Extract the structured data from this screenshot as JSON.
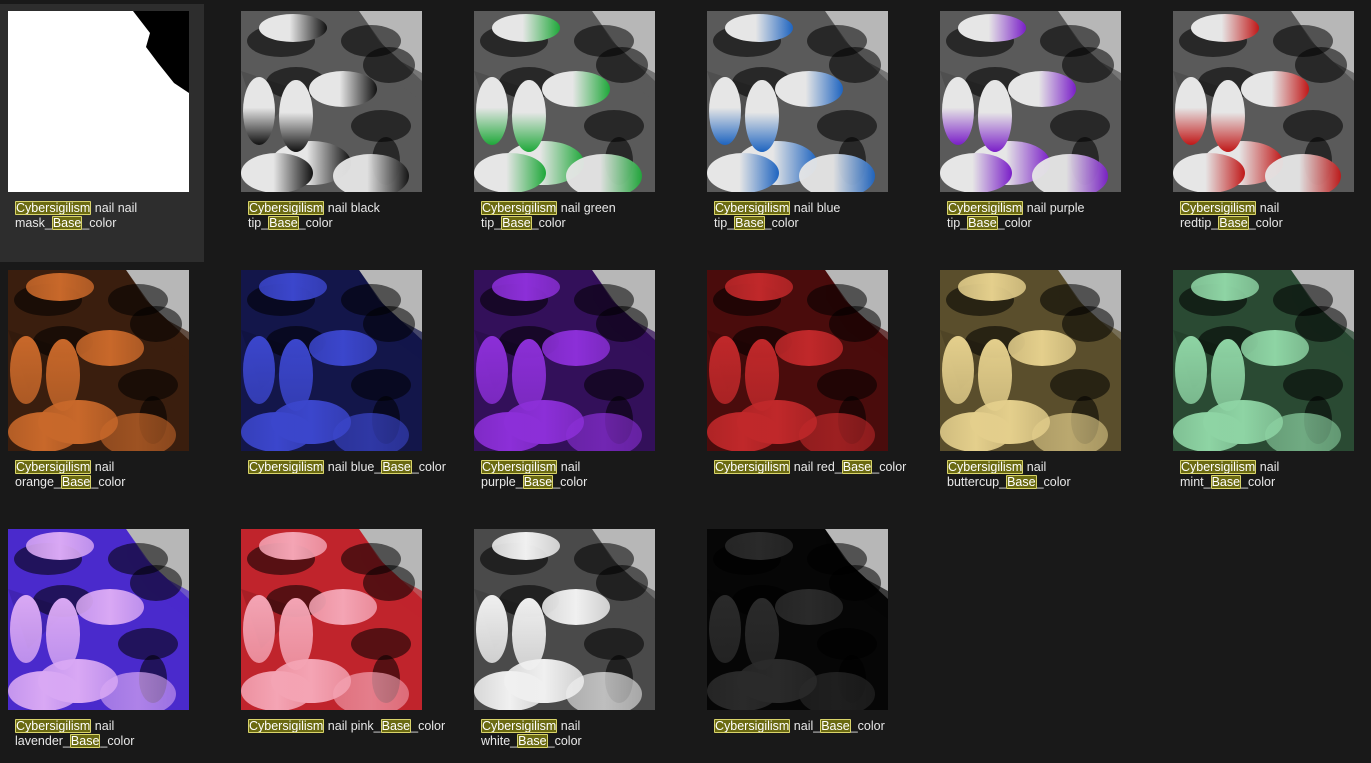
{
  "search_highlight": "Cybersigilism",
  "highlight_color": "#6b6a12",
  "items": [
    {
      "line1_pre": "",
      "hl1": "Cybersigilism",
      "line1_post": " nail nail",
      "line2_pre": "mask_",
      "hl2": "Base",
      "line2_post": "_color",
      "style": "mask",
      "base": "#ffffff",
      "tip": "#ffffff",
      "bg": "#000000",
      "selected": true
    },
    {
      "line1_pre": "",
      "hl1": "Cybersigilism",
      "line1_post": " nail black",
      "line2_pre": "tip_",
      "hl2": "Base",
      "line2_post": "_color",
      "style": "tip",
      "base": "#e6e6e6",
      "tip": "#111111",
      "bg": "#5a5a5a"
    },
    {
      "line1_pre": "",
      "hl1": "Cybersigilism",
      "line1_post": " nail green",
      "line2_pre": "tip_",
      "hl2": "Base",
      "line2_post": "_color",
      "style": "tip",
      "base": "#e6e6e6",
      "tip": "#1fa83a",
      "bg": "#5a5a5a"
    },
    {
      "line1_pre": "",
      "hl1": "Cybersigilism",
      "line1_post": " nail blue",
      "line2_pre": "tip_",
      "hl2": "Base",
      "line2_post": "_color",
      "style": "tip",
      "base": "#e6e6e6",
      "tip": "#1e64c0",
      "bg": "#5a5a5a"
    },
    {
      "line1_pre": "",
      "hl1": "Cybersigilism",
      "line1_post": " nail purple",
      "line2_pre": "tip_",
      "hl2": "Base",
      "line2_post": "_color",
      "style": "tip",
      "base": "#e6e6e6",
      "tip": "#7a1fc8",
      "bg": "#5a5a5a"
    },
    {
      "line1_pre": "",
      "hl1": "Cybersigilism",
      "line1_post": " nail",
      "line2_pre": "redtip_",
      "hl2": "Base",
      "line2_post": "_color",
      "style": "tip",
      "base": "#e6e6e6",
      "tip": "#c01818",
      "bg": "#5a5a5a"
    },
    {
      "line1_pre": "",
      "hl1": "Cybersigilism",
      "line1_post": " nail",
      "line2_pre": "orange_",
      "hl2": "Base",
      "line2_post": "_color",
      "style": "solid",
      "base": "#c8682a",
      "tip": "#c8682a",
      "bg": "#3a1e0e"
    },
    {
      "line1_pre": "",
      "hl1": "Cybersigilism",
      "line1_post": " nail blue_",
      "hl2": "Base",
      "line2_post": "_color",
      "line2_pre": "",
      "inline": true,
      "style": "solid",
      "base": "#3b46cc",
      "tip": "#3b46cc",
      "bg": "#13164a"
    },
    {
      "line1_pre": "",
      "hl1": "Cybersigilism",
      "line1_post": " nail",
      "line2_pre": "purple_",
      "hl2": "Base",
      "line2_post": "_color",
      "style": "solid",
      "base": "#8c2fd8",
      "tip": "#8c2fd8",
      "bg": "#33105a"
    },
    {
      "line1_pre": "",
      "hl1": "Cybersigilism",
      "line1_post": " nail red_",
      "hl2": "Base",
      "line2_post": "_color",
      "line2_pre": "",
      "inline": true,
      "style": "solid",
      "base": "#c0282a",
      "tip": "#c0282a",
      "bg": "#4a0c0c"
    },
    {
      "line1_pre": "",
      "hl1": "Cybersigilism",
      "line1_post": " nail",
      "line2_pre": "buttercup_",
      "hl2": "Base",
      "line2_post": "_color",
      "style": "solid",
      "base": "#e4cf8c",
      "tip": "#e4cf8c",
      "bg": "#5a4e2c"
    },
    {
      "line1_pre": "",
      "hl1": "Cybersigilism",
      "line1_post": " nail",
      "line2_pre": "mint_",
      "hl2": "Base",
      "line2_post": "_color",
      "style": "solid",
      "base": "#8ed4a4",
      "tip": "#8ed4a4",
      "bg": "#2a4a33"
    },
    {
      "line1_pre": "",
      "hl1": "Cybersigilism",
      "line1_post": " nail",
      "line2_pre": "lavender_",
      "hl2": "Base",
      "line2_post": "_color",
      "style": "solid",
      "base": "#d9a8f4",
      "tip": "#d9a8f4",
      "bg": "#4a2acc"
    },
    {
      "line1_pre": "",
      "hl1": "Cybersigilism",
      "line1_post": " nail pink_",
      "hl2": "Base",
      "line2_post": "_color",
      "line2_pre": "",
      "inline": true,
      "style": "solid",
      "base": "#f4a4b4",
      "tip": "#f4a4b4",
      "bg": "#c0242c"
    },
    {
      "line1_pre": "",
      "hl1": "Cybersigilism",
      "line1_post": " nail",
      "line2_pre": "white_",
      "hl2": "Base",
      "line2_post": "_color",
      "style": "solid",
      "base": "#f0f0f0",
      "tip": "#f0f0f0",
      "bg": "#4a4a4a"
    },
    {
      "line1_pre": "",
      "hl1": "Cybersigilism",
      "line1_post": " nail_",
      "hl2": "Base",
      "line2_post": "_color",
      "line2_pre": "",
      "inline": true,
      "style": "solid",
      "base": "#2a2a2a",
      "tip": "#2a2a2a",
      "bg": "#060606"
    }
  ]
}
